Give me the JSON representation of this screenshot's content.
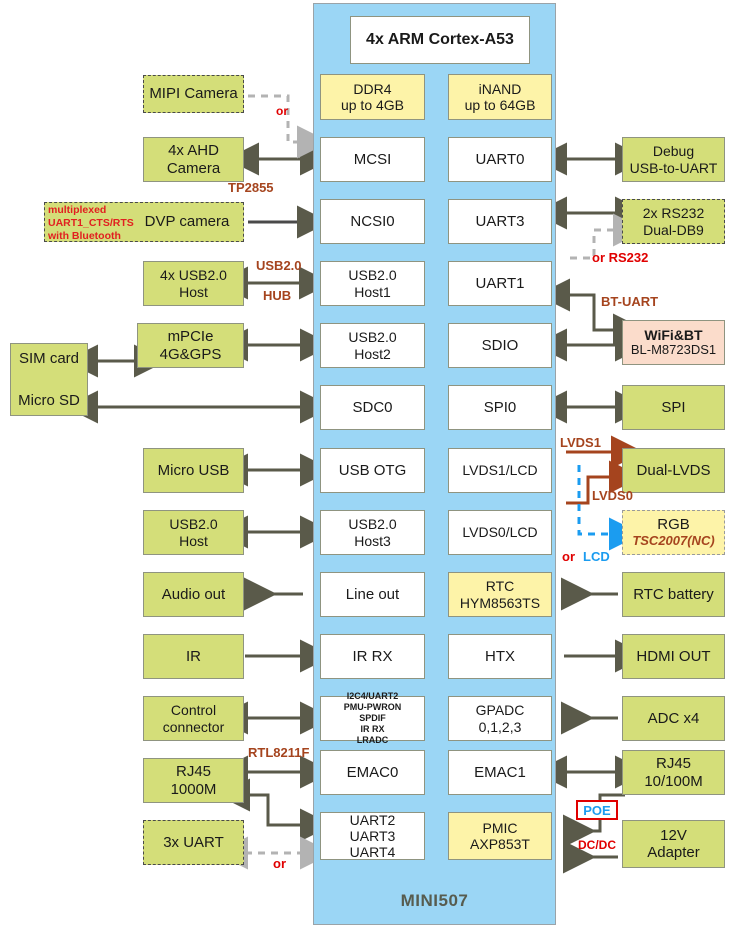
{
  "soc": {
    "title": "MINI507",
    "cpu": "4x ARM Cortex-A53",
    "blocks_left": [
      "DDR4\nup to 4GB",
      "MCSI",
      "NCSI0",
      "USB2.0\nHost1",
      "USB2.0\nHost2",
      "SDC0",
      "USB OTG",
      "USB2.0\nHost3",
      "Line out",
      "IR RX",
      "I2C4/UART2\nPMU-PWRON\nSPDIF\nIR RX\nLRADC",
      "EMAC0",
      "UART2\nUART3\nUART4"
    ],
    "blocks_right": [
      "iNAND\nup to 64GB",
      "UART0",
      "UART3",
      "UART1",
      "SDIO",
      "SPI0",
      "LVDS1/LCD",
      "LVDS0/LCD",
      "RTC\nHYM8563TS",
      "HTX",
      "GPADC\n0,1,2,3",
      "EMAC1",
      "PMIC\nAXP853T"
    ]
  },
  "peripherals_left": [
    {
      "label": "MIPI Camera",
      "style": "green-dash"
    },
    {
      "label": "4x AHD\nCamera",
      "style": "green"
    },
    {
      "label": "DVP camera",
      "style": "green-dash"
    },
    {
      "label": "4x USB2.0\nHost",
      "style": "green"
    },
    {
      "label": "mPCIe\n4G&GPS",
      "style": "green"
    },
    {
      "label": "SIM card",
      "style": "green"
    },
    {
      "label": "Micro SD",
      "style": "green"
    },
    {
      "label": "Micro USB",
      "style": "green"
    },
    {
      "label": "USB2.0\nHost",
      "style": "green"
    },
    {
      "label": "Audio out",
      "style": "green"
    },
    {
      "label": "IR",
      "style": "green"
    },
    {
      "label": "Control\nconnector",
      "style": "green"
    },
    {
      "label": "RJ45\n1000M",
      "style": "green"
    },
    {
      "label": "3x UART",
      "style": "green-dash"
    }
  ],
  "peripherals_right": [
    {
      "label": "Debug\nUSB-to-UART",
      "style": "green"
    },
    {
      "label": "2x RS232\nDual-DB9",
      "style": "green-dash"
    },
    {
      "label": "WiFi&BT",
      "sub": "BL-M8723DS1",
      "style": "pink"
    },
    {
      "label": "SPI",
      "style": "green"
    },
    {
      "label": "Dual-LVDS",
      "style": "green"
    },
    {
      "label": "RGB",
      "sub": "TSC2007(NC)",
      "style": "yellow-dash"
    },
    {
      "label": "RTC battery",
      "style": "green"
    },
    {
      "label": "HDMI OUT",
      "style": "green"
    },
    {
      "label": "ADC x4",
      "style": "green"
    },
    {
      "label": "RJ45\n10/100M",
      "style": "green"
    },
    {
      "label": "12V\nAdapter",
      "style": "green"
    }
  ],
  "annotations": {
    "or_mipi": "or",
    "tp2855": "TP2855",
    "mux_note": "multiplexed\nUART1_CTS/RTS\nwith Bluetooth",
    "usb20": "USB2.0",
    "hub": "HUB",
    "or_rs232": "or RS232",
    "bt_uart": "BT-UART",
    "lvds1": "LVDS1",
    "lvds0": "LVDS0",
    "or_lcd_or": "or",
    "or_lcd_lcd": "LCD",
    "rtl8211f": "RTL8211F",
    "or_uart": "or",
    "poe": "POE",
    "dcdc": "DC/DC",
    "rgb_nc": "NC"
  },
  "colors": {
    "soc_panel": "#9bd6f5",
    "green_block": "#d4de79",
    "yellow_block": "#fdf3a8",
    "pink_block": "#fbdccb",
    "arrow_dark": "#5a5a4a",
    "arrow_grey": "#b3b3b3",
    "arrow_brown": "#a5441e",
    "arrow_blue": "#1b9cf0",
    "red_text": "#e00000",
    "brown_text": "#a5441e"
  }
}
